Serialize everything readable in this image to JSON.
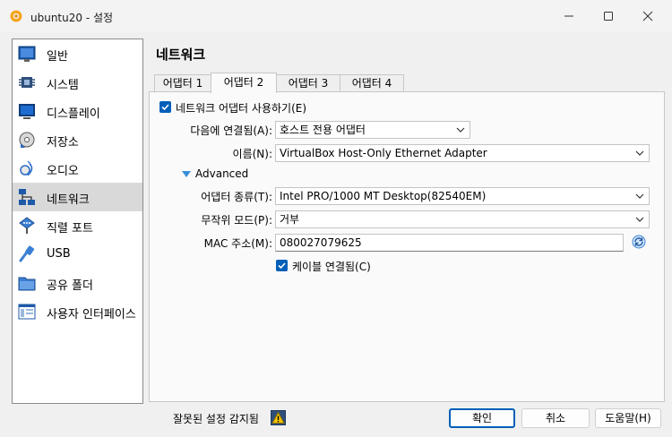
{
  "window": {
    "title": "ubuntu20 - 설정"
  },
  "sidebar": {
    "items": [
      {
        "label": "일반",
        "icon": "general-icon"
      },
      {
        "label": "시스템",
        "icon": "system-icon"
      },
      {
        "label": "디스플레이",
        "icon": "display-icon"
      },
      {
        "label": "저장소",
        "icon": "storage-icon"
      },
      {
        "label": "오디오",
        "icon": "audio-icon"
      },
      {
        "label": "네트워크",
        "icon": "network-icon",
        "selected": true
      },
      {
        "label": "직렬 포트",
        "icon": "serial-port-icon"
      },
      {
        "label": "USB",
        "icon": "usb-icon"
      },
      {
        "label": "공유 폴더",
        "icon": "shared-folder-icon"
      },
      {
        "label": "사용자 인터페이스",
        "icon": "user-interface-icon"
      }
    ]
  },
  "main": {
    "title": "네트워크",
    "tabs": [
      {
        "label": "어댑터 1",
        "accel": "1"
      },
      {
        "label": "어댑터 2",
        "accel": "2",
        "active": true
      },
      {
        "label": "어댑터 3",
        "accel": "3"
      },
      {
        "label": "어댑터 4",
        "accel": "4"
      }
    ],
    "enable_adapter": {
      "label": "네트워크 어댑터 사용하기(E)",
      "checked": true
    },
    "attached_to": {
      "label": "다음에 연결됨(A):",
      "value": "호스트 전용 어댑터"
    },
    "name": {
      "label": "이름(N):",
      "value": "VirtualBox Host-Only Ethernet Adapter"
    },
    "advanced": {
      "label": "Advanced",
      "expanded": true
    },
    "adapter_type": {
      "label": "어댑터 종류(T):",
      "value": "Intel PRO/1000 MT Desktop(82540EM)"
    },
    "promiscuous_mode": {
      "label": "무작위 모드(P):",
      "value": "거부"
    },
    "mac_address": {
      "label": "MAC 주소(M):",
      "value": "080027079625"
    },
    "cable_connected": {
      "label": "케이블 연결됨(C)",
      "checked": true
    }
  },
  "footer": {
    "warning_text": "잘못된 설정 감지됨",
    "ok_label": "확인",
    "cancel_label": "취소",
    "help_label": "도움말(H)"
  },
  "colors": {
    "accent": "#005fb8",
    "selected_bg": "#d9d9d9",
    "window_bg": "#f0f0f0"
  }
}
